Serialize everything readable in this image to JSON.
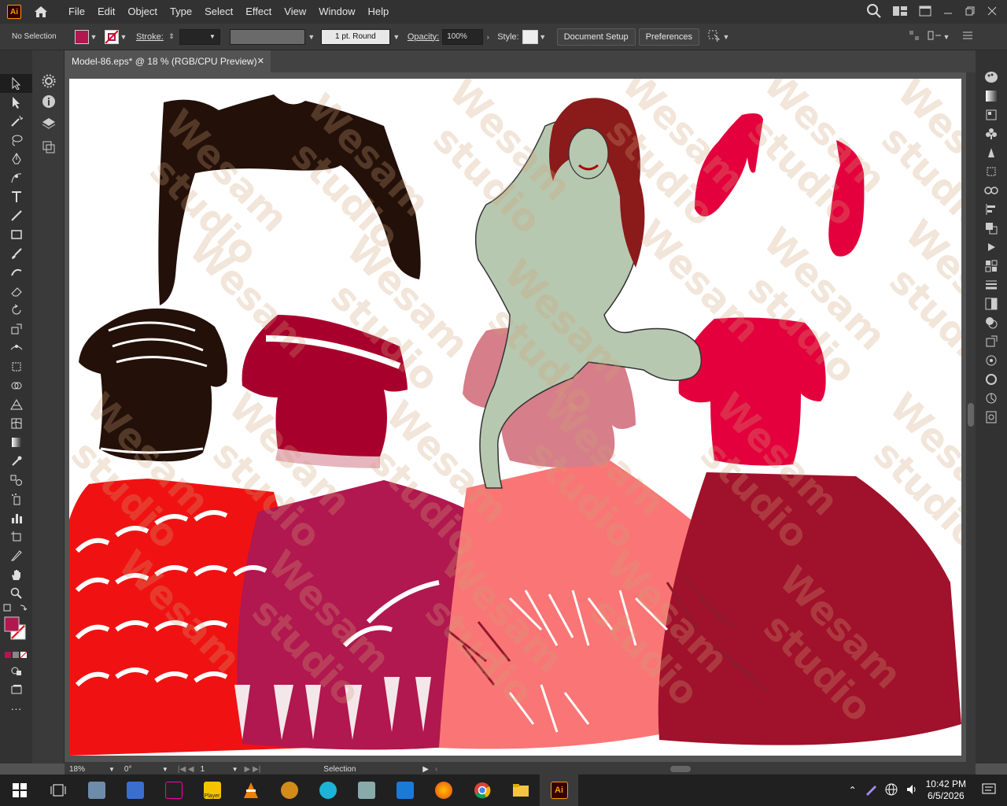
{
  "app": {
    "logo_text": "Ai"
  },
  "menu": [
    "File",
    "Edit",
    "Object",
    "Type",
    "Select",
    "Effect",
    "View",
    "Window",
    "Help"
  ],
  "control": {
    "selection_label": "No Selection",
    "stroke_label": "Stroke:",
    "stroke_profile": "1 pt. Round",
    "opacity_label": "Opacity:",
    "opacity_value": "100%",
    "style_label": "Style:",
    "document_setup": "Document Setup",
    "preferences": "Preferences"
  },
  "document": {
    "tab_title": "Model-86.eps* @ 18 % (RGB/CPU Preview)"
  },
  "status": {
    "zoom": "18%",
    "rotation": "0°",
    "artboard": "1",
    "tool": "Selection"
  },
  "watermark": {
    "line1": "Wesam",
    "line2": "studio"
  },
  "taskbar": {
    "time": "10:42 PM",
    "date": "6/5/2026",
    "ai_label": "Ai",
    "player_label": "Player"
  },
  "colors": {
    "fill": "#b0184f",
    "accent": "#ff9a00"
  }
}
